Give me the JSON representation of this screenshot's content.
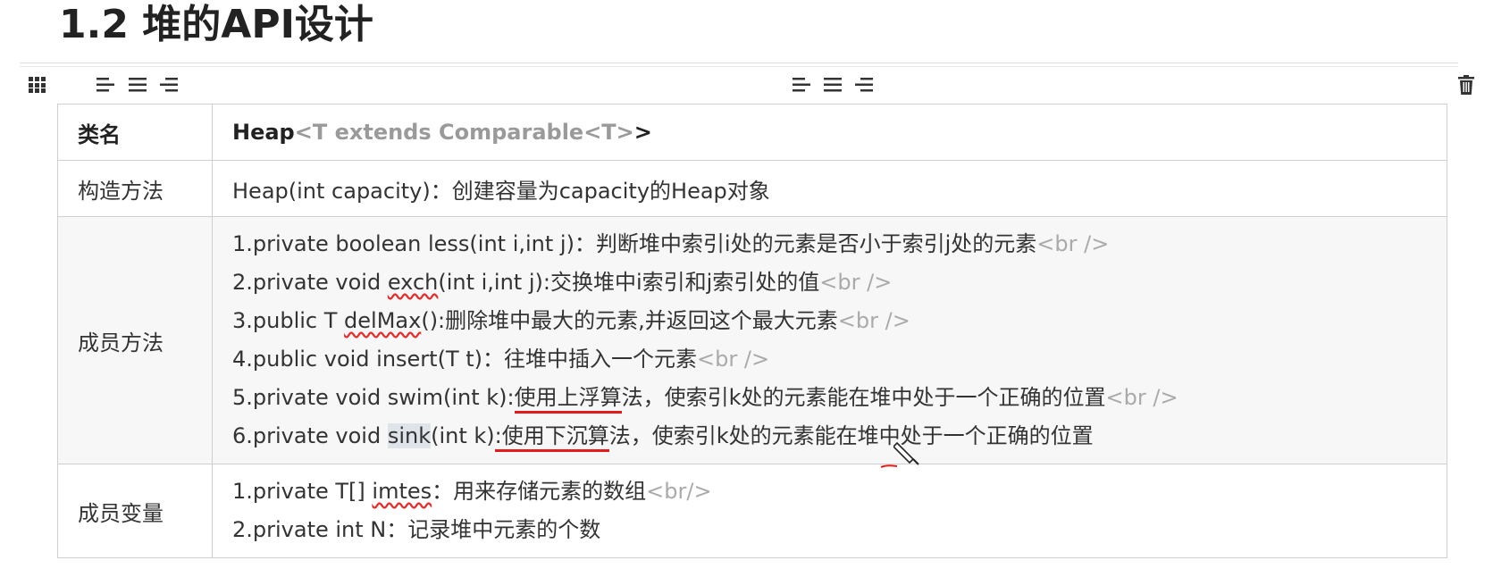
{
  "heading": "1.2 堆的API设计",
  "toolbar": {
    "grid_icon": "grid-icon",
    "align_left_1": "align-left-icon",
    "align_center_1": "align-center-icon",
    "align_right_1": "align-right-icon",
    "align_left_2": "align-left-icon",
    "align_center_2": "align-center-icon",
    "align_right_2": "align-right-icon",
    "delete_icon": "trash-icon"
  },
  "table": {
    "row1": {
      "label": "类名",
      "class_name": "Heap",
      "generic": "<T extends Comparable<T>",
      "close": ">"
    },
    "row2": {
      "label": "构造方法",
      "value": "Heap(int capacity)：创建容量为capacity的Heap对象"
    },
    "row3": {
      "label": "成员方法",
      "m1": "1.private boolean less(int i,int j)：判断堆中索引i处的元素是否小于索引j处的元素",
      "m2_a": "2.private void ",
      "m2_b": "exch",
      "m2_c": "(int i,int j):交换堆中i索引和j索引处的值",
      "m3_a": "3.public T ",
      "m3_b": "delMax",
      "m3_c": "():删除堆中最大的元素,并返回这个最大元素",
      "m4": "4.public void insert(T t)：往堆中插入一个元素",
      "m5_a": "5.private void swim(int k):",
      "m5_b": "使用上浮算",
      "m5_c": "法，使索引k处的元素能在堆中处于一个正确的位置",
      "m6_a": "6.private void ",
      "m6_b": "sink",
      "m6_c": "(int k)",
      "m6_d": ":使用下沉算",
      "m6_e": "法，使索引k处的元素能在堆中处于一个正确的位置",
      "br": "<br />"
    },
    "row4": {
      "label": "成员变量",
      "v1_a": "1.private T[] ",
      "v1_b": "imtes",
      "v1_c": "：用来存储元素的数组",
      "v1_br": "<br/>",
      "v2": "2.private int N：记录堆中元素的个数"
    }
  },
  "colors": {
    "annotation": "#e21c1c",
    "border": "#cfcfcf",
    "tag": "#aaaaaa"
  }
}
